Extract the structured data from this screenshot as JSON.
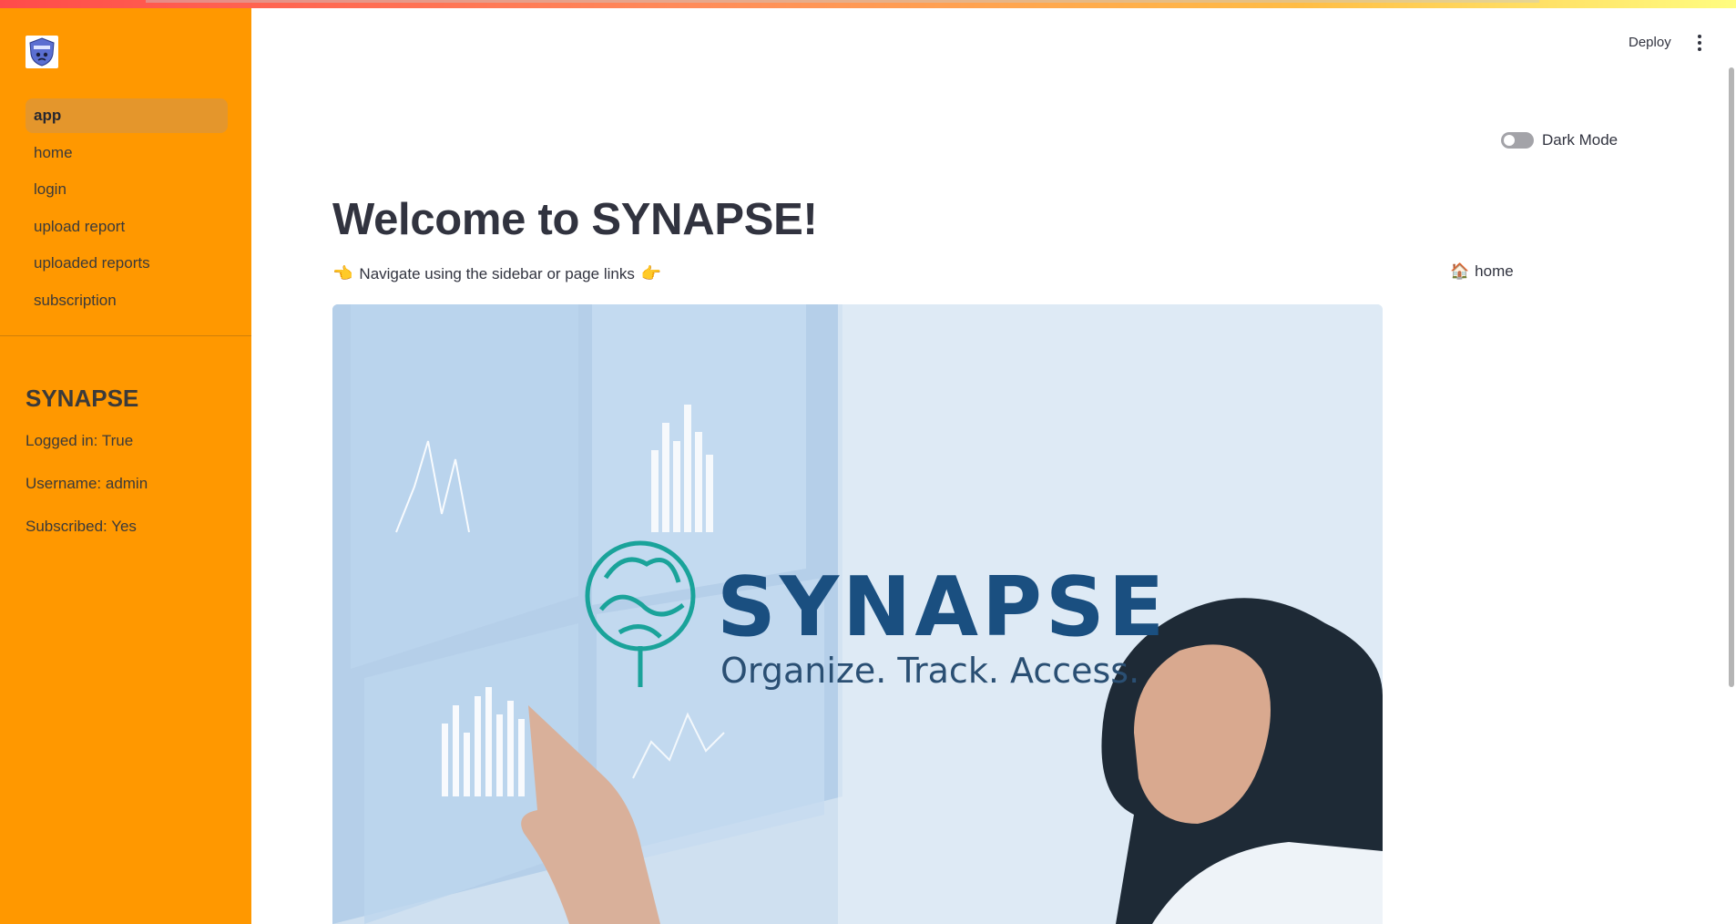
{
  "sidebar": {
    "logo_alt": "SYNAPSE",
    "nav": [
      {
        "label": "app",
        "active": true
      },
      {
        "label": "home",
        "active": false
      },
      {
        "label": "login",
        "active": false
      },
      {
        "label": "upload report",
        "active": false
      },
      {
        "label": "uploaded reports",
        "active": false
      },
      {
        "label": "subscription",
        "active": false
      }
    ],
    "title": "SYNAPSE",
    "logged_in": "Logged in: True",
    "username": "Username: admin",
    "subscribed": "Subscribed: Yes"
  },
  "header": {
    "deploy_label": "Deploy",
    "menu_icon": "kebab-menu-icon"
  },
  "toggle": {
    "label": "Dark Mode",
    "checked": false
  },
  "main": {
    "title": "Welcome to SYNAPSE!",
    "subtitle_text": "Navigate using the sidebar or page links",
    "left_hand": "👈",
    "right_hand": "👉",
    "page_link": {
      "icon": "🏠",
      "label": "home"
    },
    "hero": {
      "brand": "SYNAPSE",
      "tagline": "Organize. Track. Access."
    }
  },
  "colors": {
    "sidebar_bg": "#ff9800",
    "text": "#31333f",
    "brand_teal": "#1aa39a",
    "brand_blue": "#1a4f80"
  }
}
